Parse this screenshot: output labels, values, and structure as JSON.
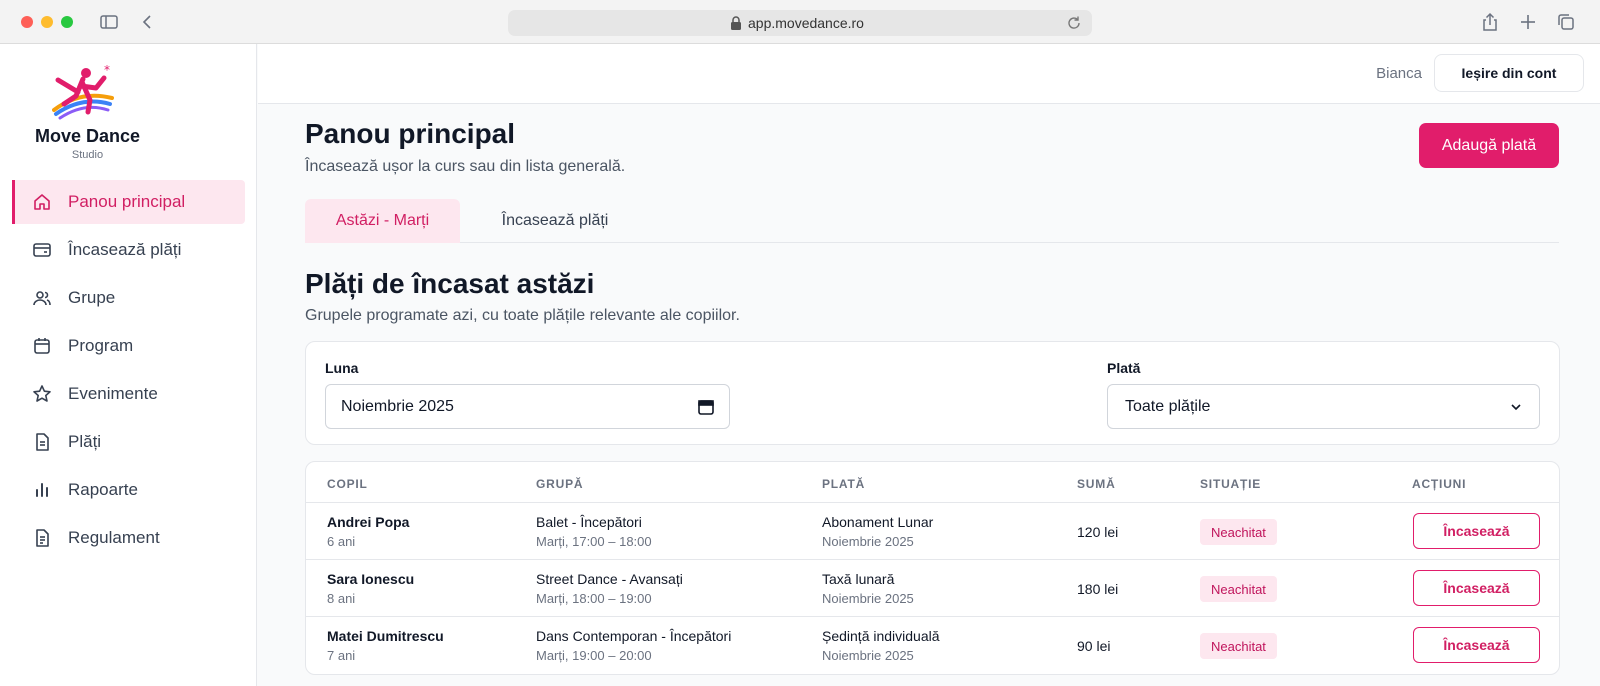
{
  "browser": {
    "url": "app.movedance.ro"
  },
  "brand": {
    "name": "Move Dance",
    "subtitle": "Studio"
  },
  "sidebar": {
    "items": [
      {
        "label": "Panou principal",
        "icon": "home-icon",
        "active": true
      },
      {
        "label": "Încasează plăți",
        "icon": "wallet-icon",
        "active": false
      },
      {
        "label": "Grupe",
        "icon": "users-icon",
        "active": false
      },
      {
        "label": "Program",
        "icon": "calendar-icon",
        "active": false
      },
      {
        "label": "Evenimente",
        "icon": "star-icon",
        "active": false
      },
      {
        "label": "Plăți",
        "icon": "document-icon",
        "active": false
      },
      {
        "label": "Rapoarte",
        "icon": "bar-chart-icon",
        "active": false
      },
      {
        "label": "Regulament",
        "icon": "file-text-icon",
        "active": false
      }
    ]
  },
  "header": {
    "user": "Bianca",
    "logout_label": "Ieșire din cont"
  },
  "main": {
    "title": "Panou principal",
    "subtitle": "Încasează ușor la curs sau din lista generală.",
    "add_payment_label": "Adaugă plată",
    "tabs": [
      {
        "label": "Astăzi - Marți",
        "active": true
      },
      {
        "label": "Încasează plăți",
        "active": false
      }
    ],
    "section_title": "Plăți de încasat astăzi",
    "section_subtitle": "Grupele programate azi, cu toate plățile relevante ale copiilor."
  },
  "filters": {
    "month_label": "Luna",
    "month_value": "Noiembrie 2025",
    "payment_label": "Plată",
    "payment_value": "Toate plățile"
  },
  "table": {
    "headers": [
      "COPIL",
      "GRUPĂ",
      "PLATĂ",
      "SUMĂ",
      "SITUAȚIE",
      "ACȚIUNI"
    ],
    "rows": [
      {
        "child": "Andrei Popa",
        "age": "6 ani",
        "group": "Balet - Începători",
        "schedule": "Marți, 17:00 – 18:00",
        "payment": "Abonament Lunar",
        "period": "Noiembrie 2025",
        "amount": "120 lei",
        "status": "Neachitat",
        "action": "Încasează"
      },
      {
        "child": "Sara Ionescu",
        "age": "8 ani",
        "group": "Street Dance - Avansați",
        "schedule": "Marți, 18:00 – 19:00",
        "payment": "Taxă lunară",
        "period": "Noiembrie 2025",
        "amount": "180 lei",
        "status": "Neachitat",
        "action": "Încasează"
      },
      {
        "child": "Matei Dumitrescu",
        "age": "7 ani",
        "group": "Dans Contemporan - Începători",
        "schedule": "Marți, 19:00 – 20:00",
        "payment": "Ședință individuală",
        "period": "Noiembrie 2025",
        "amount": "90 lei",
        "status": "Neachitat",
        "action": "Încasează"
      }
    ]
  },
  "colors": {
    "accent": "#e11d6b",
    "accent_soft": "#fde7ef"
  }
}
